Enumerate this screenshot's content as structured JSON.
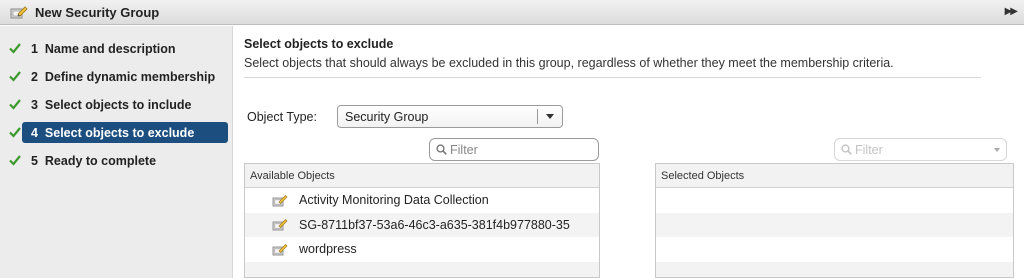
{
  "window": {
    "title": "New Security Group",
    "title_icon": "security-group-edit-icon",
    "expand_icon": "double-chevron-right-icon"
  },
  "colors": {
    "active_step_bg": "#1c4f80",
    "check_green": "#3c9a2c"
  },
  "wizard": {
    "steps": [
      {
        "number": "1",
        "label": "Name and description",
        "completed": true,
        "active": false
      },
      {
        "number": "2",
        "label": "Define dynamic membership",
        "completed": true,
        "active": false
      },
      {
        "number": "3",
        "label": "Select objects to include",
        "completed": true,
        "active": false
      },
      {
        "number": "4",
        "label": "Select objects to exclude",
        "completed": true,
        "active": true
      },
      {
        "number": "5",
        "label": "Ready to complete",
        "completed": true,
        "active": false
      }
    ]
  },
  "page": {
    "heading": "Select objects to exclude",
    "description": "Select objects that should always be excluded in this group, regardless of whether they meet the membership criteria."
  },
  "object_type": {
    "label": "Object Type:",
    "selected": "Security Group"
  },
  "available": {
    "filter_placeholder": "Filter",
    "header": "Available Objects",
    "items": [
      {
        "label": "Activity Monitoring Data Collection",
        "icon": "security-group-icon"
      },
      {
        "label": "SG-8711bf37-53a6-46c3-a635-381f4b977880-35",
        "icon": "security-group-icon"
      },
      {
        "label": "wordpress",
        "icon": "security-group-icon"
      }
    ]
  },
  "selected": {
    "filter_placeholder": "Filter",
    "header": "Selected Objects",
    "items": []
  }
}
